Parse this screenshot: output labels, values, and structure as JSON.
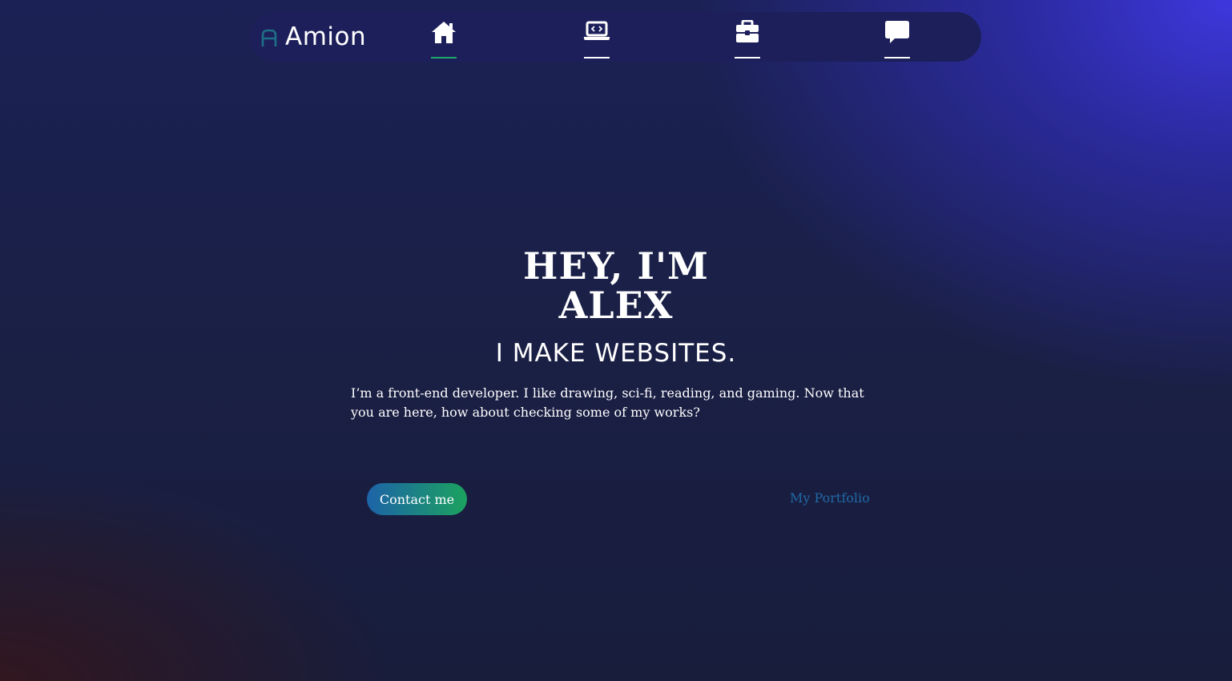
{
  "brand": {
    "logo_letter_icon": "a-logo-icon",
    "name": "Amion"
  },
  "nav": {
    "items": [
      {
        "id": "home",
        "icon": "home-icon",
        "active": true
      },
      {
        "id": "projects",
        "icon": "laptop-code-icon",
        "active": false
      },
      {
        "id": "work",
        "icon": "briefcase-icon",
        "active": false
      },
      {
        "id": "contact",
        "icon": "chat-bubble-icon",
        "active": false
      }
    ]
  },
  "hero": {
    "title_line1": "HEY, I'M",
    "title_line2": "ALEX",
    "subtitle": "I MAKE WEBSITES.",
    "description": "I’m a front-end developer. I like drawing, sci-fi, reading, and gaming. Now that you are here, how about checking some of my works?",
    "contact_button": "Contact me",
    "portfolio_link": "My Portfolio"
  },
  "colors": {
    "nav_background": "#1d1f5b",
    "accent_green": "#1fa86a",
    "accent_blue": "#1d63a8",
    "logo_mark": "#1e6f86",
    "link_color": "#2068a5"
  }
}
